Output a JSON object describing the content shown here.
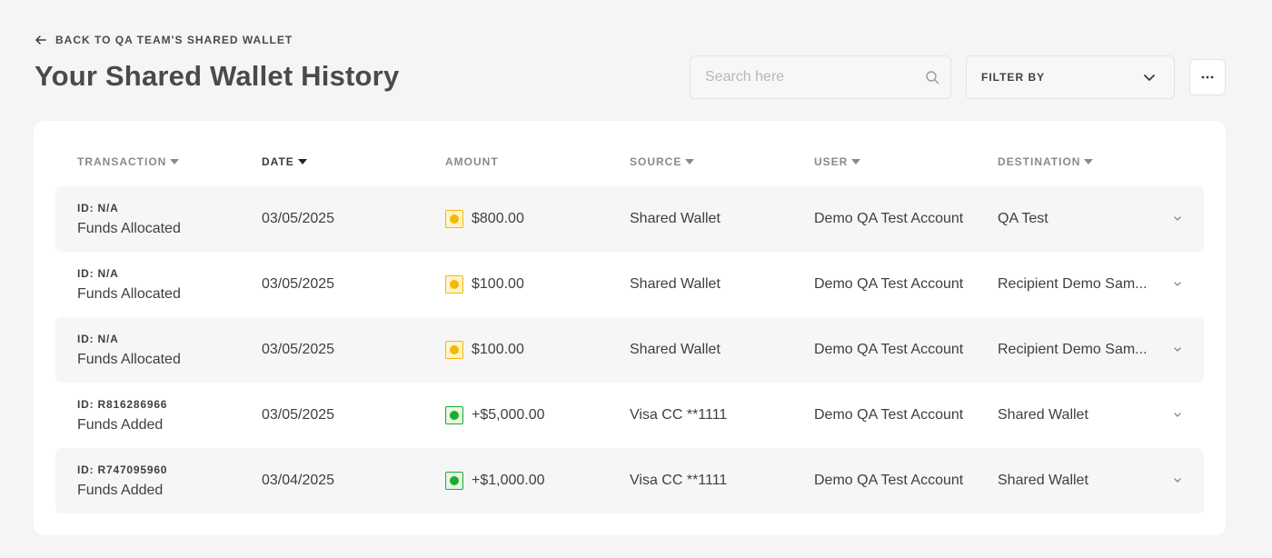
{
  "header": {
    "back_label": "BACK TO QA TEAM'S SHARED WALLET",
    "title": "Your Shared Wallet History"
  },
  "search": {
    "placeholder": "Search here",
    "value": ""
  },
  "filter": {
    "label": "FILTER BY"
  },
  "table": {
    "columns": {
      "transaction": "TRANSACTION",
      "date": "DATE",
      "amount": "AMOUNT",
      "source": "SOURCE",
      "user": "USER",
      "destination": "DESTINATION"
    },
    "rows": [
      {
        "id": "ID: N/A",
        "type": "Funds Allocated",
        "date": "03/05/2025",
        "amount": "$800.00",
        "status": "allocated",
        "source": "Shared Wallet",
        "user": "Demo QA Test Account",
        "destination": "QA Test"
      },
      {
        "id": "ID: N/A",
        "type": "Funds Allocated",
        "date": "03/05/2025",
        "amount": "$100.00",
        "status": "allocated",
        "source": "Shared Wallet",
        "user": "Demo QA Test Account",
        "destination": "Recipient Demo Sam..."
      },
      {
        "id": "ID: N/A",
        "type": "Funds Allocated",
        "date": "03/05/2025",
        "amount": "$100.00",
        "status": "allocated",
        "source": "Shared Wallet",
        "user": "Demo QA Test Account",
        "destination": "Recipient Demo Sam..."
      },
      {
        "id": "ID: R816286966",
        "type": "Funds Added",
        "date": "03/05/2025",
        "amount": "+$5,000.00",
        "status": "added",
        "source": "Visa CC **1111",
        "user": "Demo QA Test Account",
        "destination": "Shared Wallet"
      },
      {
        "id": "ID: R747095960",
        "type": "Funds Added",
        "date": "03/04/2025",
        "amount": "+$1,000.00",
        "status": "added",
        "source": "Visa CC **1111",
        "user": "Demo QA Test Account",
        "destination": "Shared Wallet"
      }
    ]
  },
  "colors": {
    "allocated_fill": "#fff3cc",
    "allocated_border": "#f5b800",
    "allocated_dot": "#f5b800",
    "added_fill": "#e3f7e3",
    "added_border": "#1faa2e",
    "added_dot": "#1faa2e"
  }
}
